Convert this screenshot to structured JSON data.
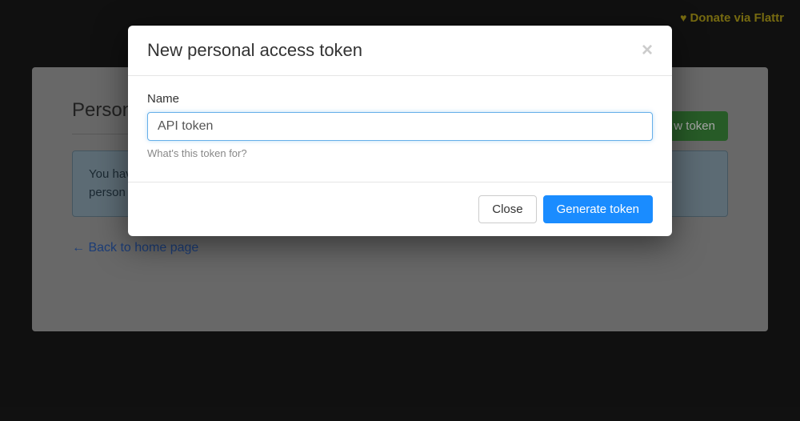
{
  "topbar": {
    "donate_label": "Donate via Flattr"
  },
  "page": {
    "title_visible": "Person",
    "new_token_btn_visible": "w token",
    "info_line1": "You hav",
    "info_line2": "person",
    "back_link": "← Back to home page"
  },
  "modal": {
    "title": "New personal access token",
    "name_label": "Name",
    "name_value": "API token",
    "help_text": "What's this token for?",
    "close_label": "Close",
    "generate_label": "Generate token"
  }
}
